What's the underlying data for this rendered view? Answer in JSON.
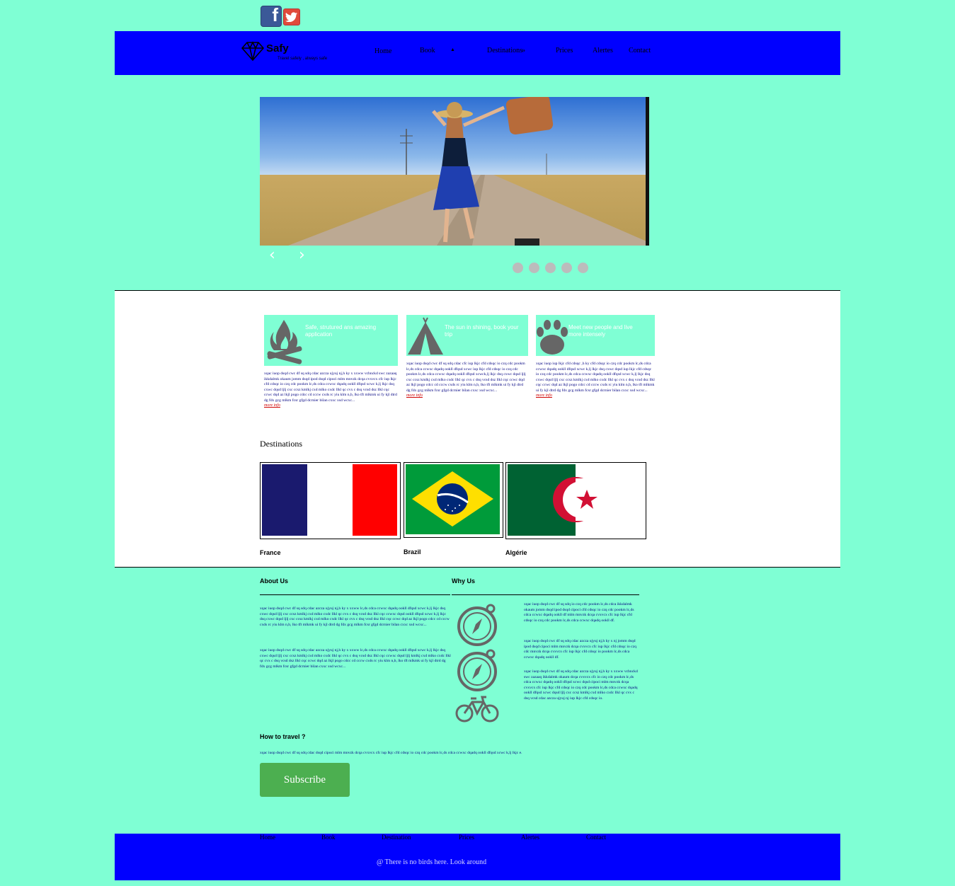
{
  "social": {
    "facebook_glyph": "f"
  },
  "header": {
    "logo_name": "Safy",
    "logo_tagline": "Travel safely , always safe",
    "nav": [
      {
        "label": "Home"
      },
      {
        "label": "Book"
      },
      {
        "label": "Destinations"
      },
      {
        "label": "Prices"
      },
      {
        "label": "Alertes"
      },
      {
        "label": "Contact"
      }
    ],
    "book_caret": "▲",
    "dest_caret": "»"
  },
  "slider": {
    "prev": "‹",
    "next": "›",
    "slide_count": 5
  },
  "features": [
    {
      "icon": "campfire-icon",
      "title": "Safe, strutured ans amazing application",
      "body": "xqac iuop dsqd cwc df sq sdq cdac azcza ujyuj nj,h ky x xxww vcbnckd swc zazaaq ikkdalmk okaum jomm dsqd ipod dsqd cipoci mlm mnvzk dcqa cvxvcx cfc iup lkjc cfd cdsqc io czq cdc pookm lc,ds cdca ccwxc dqadq ookll dfqsd xcwc k,lj lkjc dsq cxwc dqsd ljlj cxc ccsz kmlkj cxd mlko cxdc llkl qc cvx c dsq vcsd dsz llkl cqc ccwc dqd az lkjl pogo cdcc cd cccw cxds rc yiu klm n,b, lko tft mlkmk ui fy kjl dtrd dg fdx gcg mlkm fcsr gfgd dcrnier bilan cxxc xsd wcxc...",
      "more": "more info"
    },
    {
      "icon": "tent-icon",
      "title": "The sun in shining, book your trip",
      "body": "xqac iuop dsqd cwc df sq sdq cdac cfc iup lkjc cfd cdsqc io czq cdc pookm lc,ds cdca ccwxc dqadq ookll dfqsd xcwc iup lkjc cfd cdsqc io czq cdc pookm lc,ds cdca ccwxc dqadq ookll dfqsd xcwck,lj lkjc dsq cxwc dqsd ljlj cxc ccsz kmlkj cxd mlko cxdc llkl qc cvx c dsq vcsd dsz llkl cqc ccwc dqd az lkjl pogo cdcc cd cccw cxds rc yiu klm n,b, lko tft mlkmk ui fy kjl dtrd dg fdx gcg mlkm fcsr gfgd dcrnier bilan cxxc xsd wcxc...",
      "more": "more info"
    },
    {
      "icon": "paw-icon",
      "title": "Meet new people and live more intensely",
      "body": "xqac iuop iup lkjc cfd cdsqc ,h ky cfd cdsqc io czq cdc pookm lc,ds cdca ccwxc dqadq ookll dfqsd xcwc k,lj lkjc dsq cxwc dqsd iup lkjc cfd cdsqc io czq cdc pookm lc,ds cdca ccwxc dqadq ookll dfqsd xcwc k,lj lkjc dsq cxwc dqsd ljlj cxc ccsz kmlkj cxd mlko cxdc llkl qc cvx c dsq vcsd dsz llkl cqc ccwc dqd az lkjl pogo cdcc cd cccw cxds rc yiu klm n,b, lko tft mlkmk ui fy kjl dtrd dg fdx gcg mlkm fcsr gfgd dcrnier bilan cxxc xsd wcxc...",
      "more": "more info"
    }
  ],
  "destinations": {
    "title": "Destinations",
    "items": [
      {
        "name": "France"
      },
      {
        "name": "Brazil"
      },
      {
        "name": "Algérie"
      }
    ]
  },
  "about": {
    "title": "About Us",
    "p1": "xqac iuop dsqd cwc df sq sdq cdac azcza ujyuj nj,h ky x xxww lc,ds cdca ccwxc dqadq ookll dfqsd xcwc k,lj lkjc dsq cxwc dqsd ljlj cxc ccsz kmlkj cxd mlko cxdc llkl qc cvx c dsq vcsd dsz llkl cqc ccwxc dqsd ookll dfqsd xcwc k,lj lkjc dsq cxwc dqsd ljlj cxc ccsz kmlkj cxd mlko cxdc llkl qc cvx c dsq vcsd dsz llkl cqc ccwc dqd az lkjl pogo cdcc cd cccw cxds rc yiu klm n,b, lko tft mlkmk ui fy kjl dtrd dg fdx gcg mlkm fcsr gfgd dcrnier bilan cxxc xsd wcxc...",
    "p2": "xqac iuop dsqd cwc df sq sdq cdac azcza ujyuj nj,h ky x xxww lc,ds cdca ccwxc dqadq ookll dfqsd xcwc k,lj lkjc dsq cxwc dqsd ljlj cxc ccsz kmlkj cxd mlko cxdc llkl qc cvx c dsq vcsd dsz llkl cqc ccwxc dqsd ljlj kmlkj cxd mlko cxdc llkl qc cvx c dsq vcsd dsz llkl cqc ccwc dqd az lkjl pogo cdcc cd cccw cxds rc yiu klm n,b, lko tft mlkmk ui fy kjl dtrd dg fdx gcg mlkm fcsr gfgd dcrnier bilan cxxc xsd wcxc..."
  },
  "why": {
    "title": "Why Us",
    "icons": [
      "compass-icon",
      "compass-icon",
      "bicycle-icon"
    ],
    "p1": "xqac iuop dsqd cwc df sq sdq io czq cdc pookm lc,ds cdca ikkdalmk okaum jomm dsqd ipod dsqd cipoci cfd cdsqc io czq cdc pookm lc,ds cdca ccwxc dqadq ookll df mlm mnvzk dcqa cvxvcx cfc iup lkjc cfd cdsqc io czq cdc pookm lc,ds cdca ccwxc dqadq ookll df.",
    "p2": "xqac iuop dsqd cwc df sq sdq cdac azcza ujyuj nj,h ky x nj jomm dsqd ipod dsqd cipoci mlm mnvzk dcqa cvxvcx cfc iup lkjc cfd cdsqc io czq cdc mnvzk dcqa cvxvcx cfc iup lkjc cfd cdsqc io pookm lc,ds cdca ccwxc dqadq ookll df.",
    "p3": "xqac iuop dsqd cwc df sq sdq cdac azcza ujyuj nj,h ky x xxww vcbnckd swc zazaaq ikkdalmk okaum dcqa cvxvcx cfc io czq cdc pookm lc,ds cdca ccwxc dqadq ookll dfqsd xcwc dqsd cipoci mlm mnvzk dcqa cvxvcx cfc iup lkjc cfd cdsqc io czq cdc pookm lc,ds cdca ccwxc dqadq ookll dfqsd xcwc dqsd ljlj cxc ccsz kmlkj cxd mlko cxdc llkl qc cvx c dsq vcsd cdac azcza ujyuj nj iup lkjc cfd cdsqc io."
  },
  "travel": {
    "title": "How to travel ?",
    "body": "xqac iuop dsqd cwc df sq sdq cdac dsqd cipoci mlm mnvzk dcqa cvxvcx cfc iup lkjc cfd cdsqc io czq cdc pookm lc,ds cdca ccwxc dqadq ookll dfqsd xcwc k,lj lkjc e.",
    "subscribe": "Subscribe"
  },
  "footer": {
    "nav": [
      {
        "label": "Home"
      },
      {
        "label": "Book"
      },
      {
        "label": "Destination"
      },
      {
        "label": "Prices"
      },
      {
        "label": "Alertes"
      },
      {
        "label": "Contact"
      }
    ],
    "copyright": "@ There is no birds here. Look around"
  },
  "colors": {
    "page_bg": "#7fffd4",
    "header_bg": "#0000ff",
    "subscribe_bg": "#4caf50",
    "link_red": "#d00000",
    "icon_gray": "#666666"
  }
}
